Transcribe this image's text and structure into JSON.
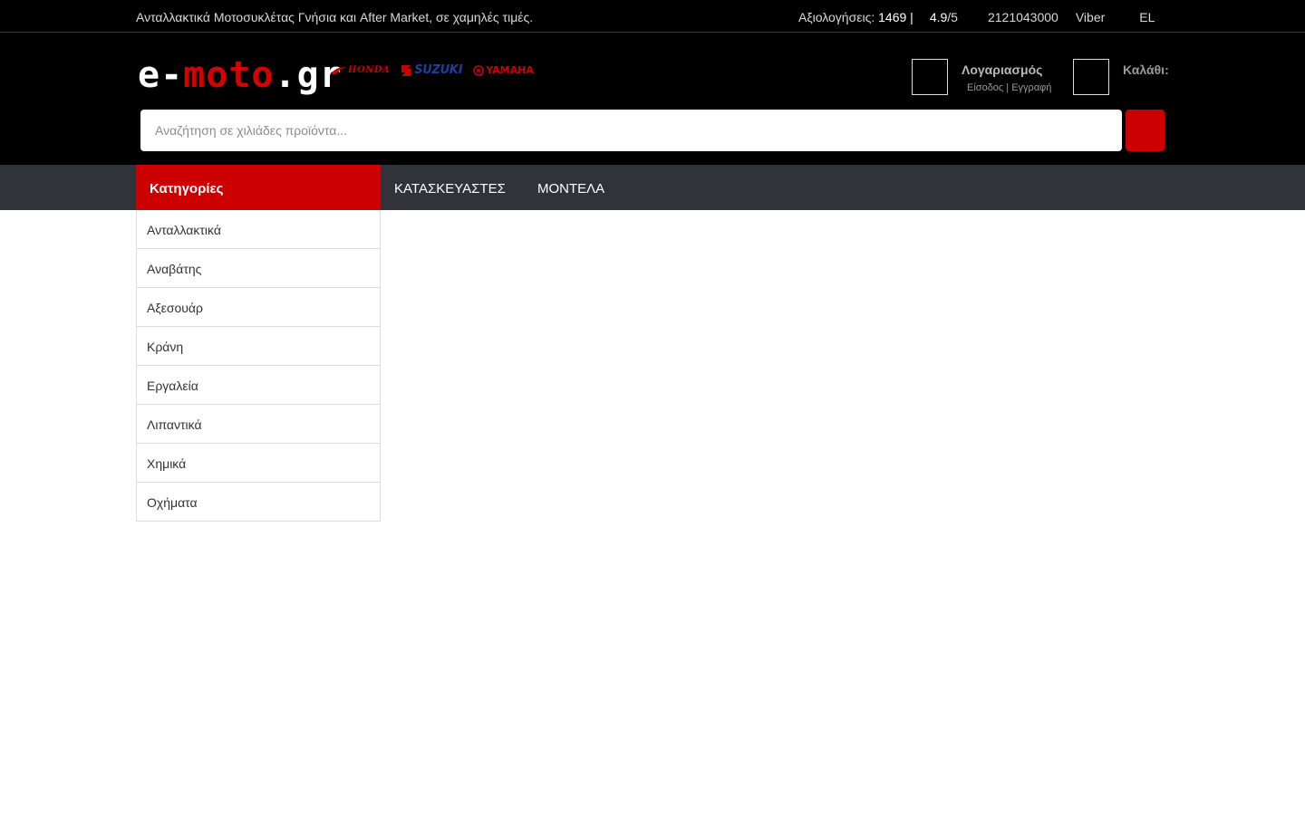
{
  "topbar": {
    "tagline": "Ανταλλακτικά Μοτοσυκλέτας Γνήσια και After Market, σε χαμηλές τιμές.",
    "reviews_label": "Αξιολογήσεις: ",
    "reviews_count": "1469",
    "separator": " |",
    "rating_value": "4.9",
    "rating_max": "/5",
    "phone": "2121043000",
    "viber": "Viber",
    "language": "EL"
  },
  "header": {
    "logo_prefix": "e-",
    "logo_middle": "moto",
    "logo_suffix": ".gr",
    "brands": {
      "honda": "HONDA",
      "suzuki": "SUZUKI",
      "yamaha": "YAMAHA"
    },
    "account_title": "Λογαριασμός",
    "login_link": "Είσοδος",
    "links_separator": " | ",
    "register_link": "Εγγραφή",
    "cart_label": "Καλάθι:"
  },
  "search": {
    "placeholder": "Αναζήτηση σε χιλιάδες προϊόντα..."
  },
  "nav": {
    "categories_label": "Κατηγορίες",
    "manufacturers_label": "ΚΑΤΑΣΚΕΥΑΣΤΕΣ",
    "models_label": "ΜΟΝΤΕΛΑ"
  },
  "categories": [
    "Ανταλλακτικά",
    "Αναβάτης",
    "Αξεσουάρ",
    "Κράνη",
    "Εργαλεία",
    "Λιπαντικά",
    "Χημικά",
    "Οχήματα"
  ],
  "colors": {
    "accent": "#cc0000",
    "header_bg": "#000000",
    "nav_bg": "#31333a"
  }
}
